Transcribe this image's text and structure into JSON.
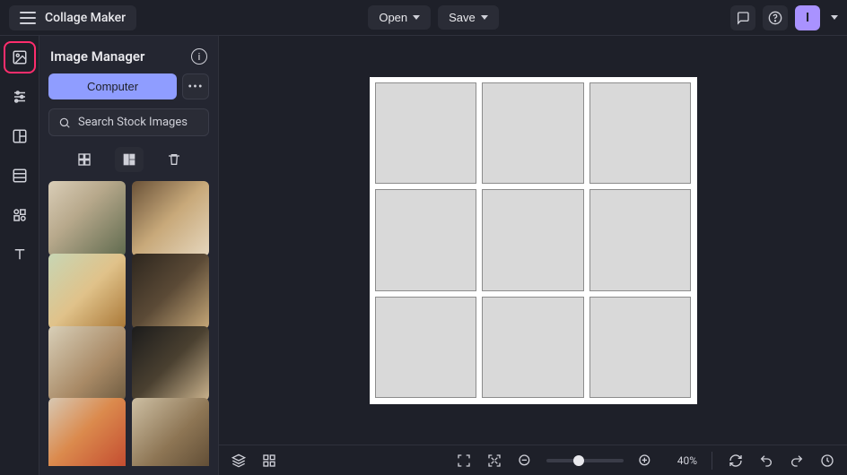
{
  "app": {
    "title": "Collage Maker"
  },
  "topbar": {
    "open_label": "Open",
    "save_label": "Save",
    "avatar_letter": "I"
  },
  "panel": {
    "title": "Image Manager",
    "computer_label": "Computer",
    "more_label": "•••",
    "search_stock_label": "Search Stock Images"
  },
  "canvas": {
    "grid_rows": 3,
    "grid_cols": 3
  },
  "bottombar": {
    "zoom_percent_label": "40%",
    "zoom_value": 40
  }
}
